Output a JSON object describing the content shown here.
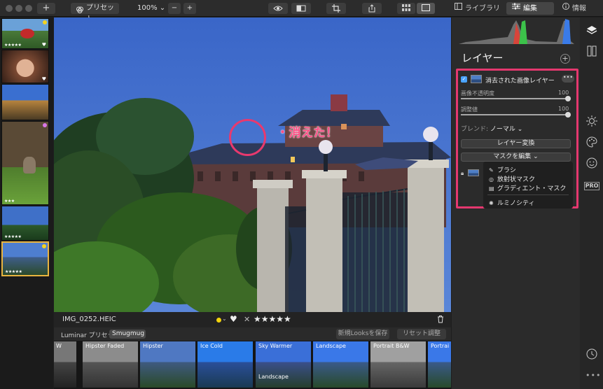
{
  "toolbar": {
    "add_label": "+",
    "preset_label": "プリセット",
    "zoom_value": "100%",
    "zoom_caret": "⌄",
    "zoom_minus": "−",
    "zoom_plus": "+",
    "tabs": [
      {
        "label": "ライブラリ"
      },
      {
        "label": "編集"
      },
      {
        "label": "情報"
      }
    ]
  },
  "filmstrip": {
    "thumbs": [
      {
        "stars": "★★★★★",
        "heart": "♥"
      },
      {
        "stars": "",
        "heart": "♥"
      },
      {
        "stars": "",
        "heart": ""
      },
      {
        "stars": "★★★",
        "heart": ""
      },
      {
        "stars": "★★★★★",
        "heart": ""
      },
      {
        "stars": "★★★★★",
        "heart": ""
      }
    ],
    "dot_colors": [
      "#f4d320",
      "#d877e6",
      "#f4d320"
    ]
  },
  "annotation": {
    "text": "・消えた！",
    "color": "#e8396e"
  },
  "infobar": {
    "filename": "IMG_0252.HEIC",
    "caret": "⌄",
    "heart": "♥",
    "reject": "✕",
    "stars": "★★★★★"
  },
  "looksbar": {
    "label": "Luminar プリセット",
    "collection": "Smugmug",
    "save_button": "新規Looksを保存",
    "reset_button": "リセット調整"
  },
  "looks": [
    {
      "name": "W",
      "name2": ""
    },
    {
      "name": "Hipster Faded",
      "name2": ""
    },
    {
      "name": "Hipster",
      "name2": ""
    },
    {
      "name": "Ice Cold",
      "name2": ""
    },
    {
      "name": "Sky Warmer",
      "name2": "Landscape"
    },
    {
      "name": "Landscape",
      "name2": ""
    },
    {
      "name": "Portrait B&W",
      "name2": ""
    },
    {
      "name": "Portrai",
      "name2": ""
    }
  ],
  "panel": {
    "title": "レイヤー",
    "add_button": "+",
    "layer_name": "消去された画像レイヤー",
    "more_label": "•••",
    "opacity_label": "画像不透明度",
    "opacity_value": "100",
    "adjust_label": "調整値",
    "adjust_value": "100",
    "blend_label": "ブレンド: ",
    "blend_value": "ノーマル ⌄",
    "transform_button": "レイヤー変換",
    "mask_button": "マスクを編集 ⌄",
    "menu": [
      {
        "icon": "brush-icon",
        "label": "ブラシ"
      },
      {
        "icon": "radial-mask-icon",
        "label": "放射状マスク"
      },
      {
        "icon": "gradient-mask-icon",
        "label": "グラディエント・マスク"
      },
      {
        "icon": "luminosity-icon",
        "label": "ルミノシティ"
      }
    ],
    "highlight_color": "#e5386f"
  },
  "sidebar": {
    "pro_label": "PRO",
    "more_dots": "•••"
  }
}
